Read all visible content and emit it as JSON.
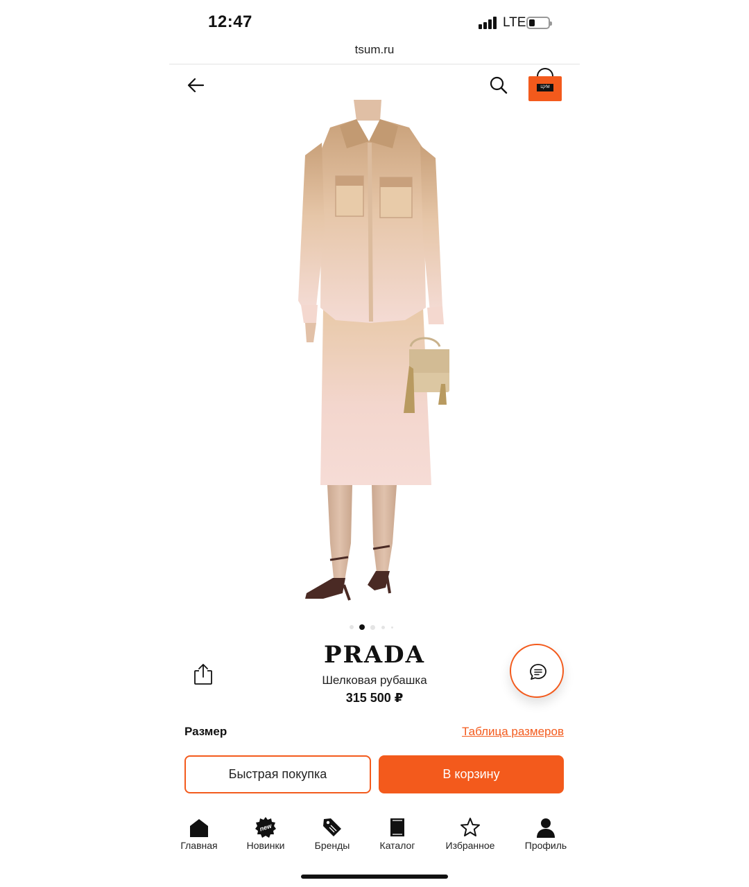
{
  "status_bar": {
    "time": "12:47",
    "network": "LTE"
  },
  "browser": {
    "url": "tsum.ru"
  },
  "header": {
    "back_icon": "arrow-left-icon",
    "search_icon": "search-icon",
    "cart_icon": "shopping-bag-icon"
  },
  "gallery": {
    "total": 5,
    "active": 2
  },
  "product": {
    "brand": "PRADA",
    "name": "Шелковая рубашка",
    "price": "315 500 ₽"
  },
  "size": {
    "label": "Размер",
    "table_link": "Таблица размеров"
  },
  "actions": {
    "quick_buy": "Быстрая покупка",
    "add_to_cart": "В корзину"
  },
  "tabbar": {
    "items": [
      {
        "label": "Главная",
        "icon": "home-icon"
      },
      {
        "label": "Новинки",
        "icon": "new-badge-icon",
        "badge": "new"
      },
      {
        "label": "Бренды",
        "icon": "tag-icon"
      },
      {
        "label": "Каталог",
        "icon": "book-icon"
      },
      {
        "label": "Избранное",
        "icon": "star-icon"
      },
      {
        "label": "Профиль",
        "icon": "user-icon"
      }
    ]
  },
  "colors": {
    "accent": "#f35a1c"
  }
}
